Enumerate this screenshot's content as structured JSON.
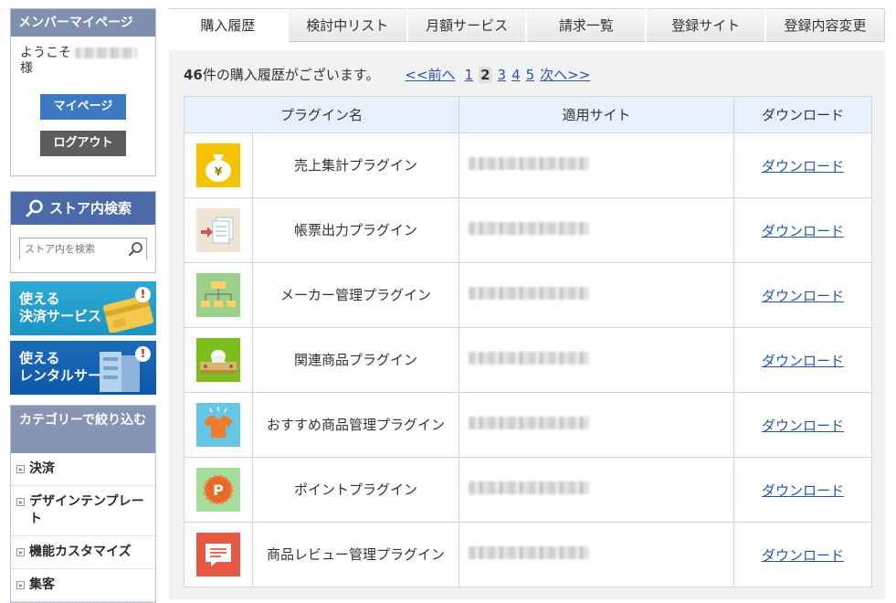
{
  "sidebar": {
    "member": {
      "title": "メンバーマイページ",
      "welcome_prefix": "ようこそ",
      "welcome_suffix": "様",
      "mypage_label": "マイページ",
      "logout_label": "ログアウト"
    },
    "search": {
      "title": "ストア内検索",
      "placeholder": "ストア内を検索"
    },
    "banners": [
      {
        "line1": "使える",
        "line2": "決済サービス"
      },
      {
        "line1": "使える",
        "line2": "レンタルサーバ"
      }
    ],
    "category": {
      "title": "カテゴリーで絞り込む",
      "items": [
        {
          "label": "決済"
        },
        {
          "label": "デザインテンプレート"
        },
        {
          "label": "機能カスタマイズ"
        },
        {
          "label": "集客"
        }
      ]
    }
  },
  "tabs": [
    {
      "label": "購入履歴",
      "active": true
    },
    {
      "label": "検討中リスト"
    },
    {
      "label": "月額サービス"
    },
    {
      "label": "請求一覧"
    },
    {
      "label": "登録サイト"
    },
    {
      "label": "登録内容変更"
    }
  ],
  "summary": {
    "count": "46",
    "text": "件の購入履歴がございます。",
    "prev": "<<前へ",
    "pages": [
      "1",
      "2",
      "3",
      "4",
      "5"
    ],
    "current_page": "2",
    "next": "次へ>>"
  },
  "table": {
    "headers": [
      "プラグイン名",
      "適用サイト",
      "ダウンロード"
    ],
    "rows": [
      {
        "name": "売上集計プラグイン",
        "icon": "money-bag-icon",
        "download": "ダウンロード"
      },
      {
        "name": "帳票出力プラグイン",
        "icon": "document-output-icon",
        "download": "ダウンロード"
      },
      {
        "name": "メーカー管理プラグイン",
        "icon": "org-chart-icon",
        "download": "ダウンロード"
      },
      {
        "name": "関連商品プラグイン",
        "icon": "related-items-icon",
        "download": "ダウンロード"
      },
      {
        "name": "おすすめ商品管理プラグイン",
        "icon": "shirt-icon",
        "download": "ダウンロード"
      },
      {
        "name": "ポイントプラグイン",
        "icon": "point-icon",
        "download": "ダウンロード"
      },
      {
        "name": "商品レビュー管理プラグイン",
        "icon": "review-icon",
        "download": "ダウンロード"
      }
    ]
  },
  "colors": {
    "accent_blue": "#3d7ac3",
    "link": "#2255aa",
    "sidebar_header": "#7f8fae"
  }
}
